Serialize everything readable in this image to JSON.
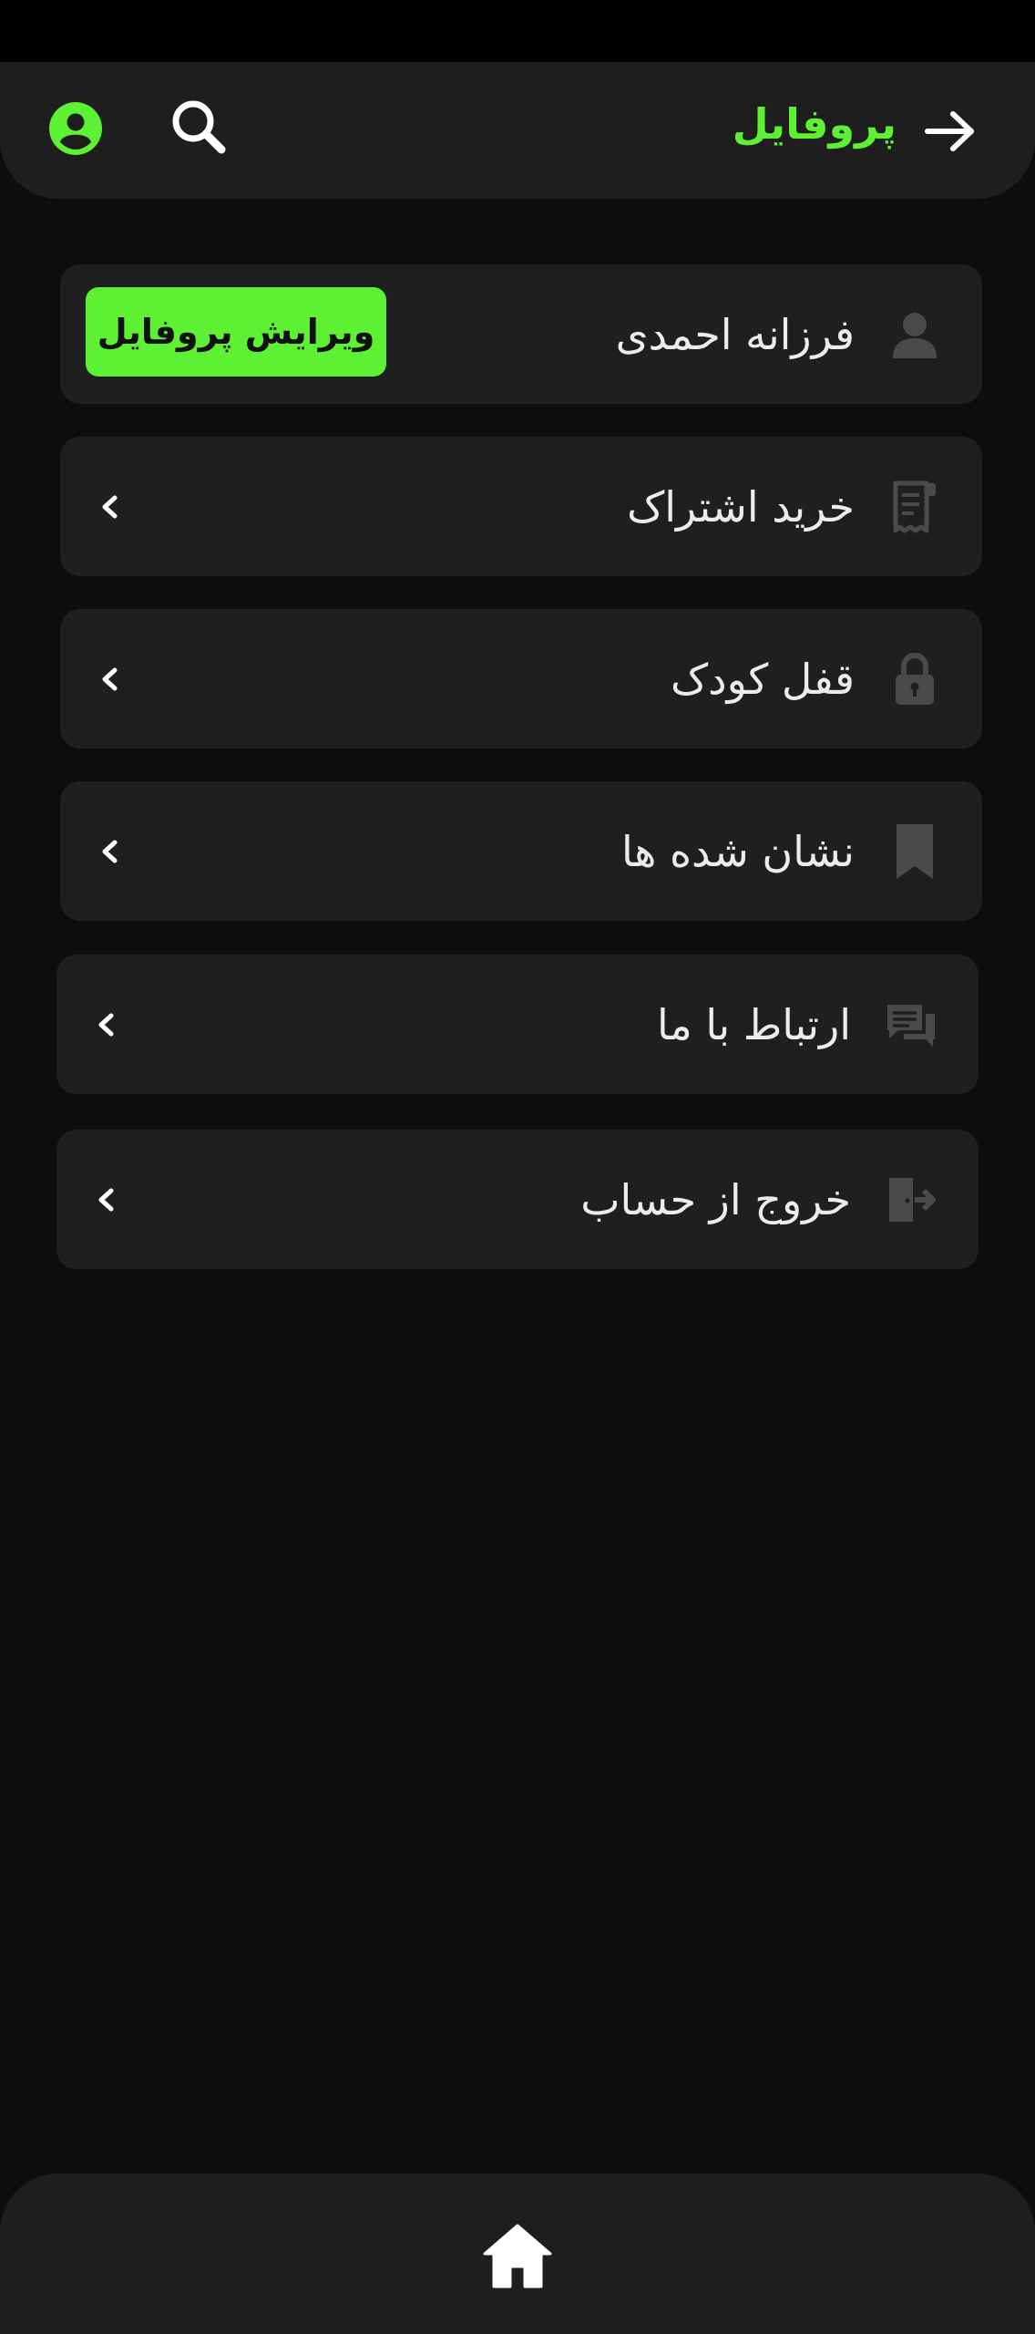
{
  "header": {
    "title": "پروفایل",
    "icons": {
      "back": "arrow-right-icon",
      "search": "search-icon",
      "profile": "account-circle-icon"
    }
  },
  "profile_card": {
    "user_name": "فرزانه احمدی",
    "edit_button_label": "ویرایش پروفایل",
    "icon": "user-icon"
  },
  "menu": {
    "items": [
      {
        "label": "خرید اشتراک",
        "icon": "receipt-icon"
      },
      {
        "label": "قفل کودک",
        "icon": "lock-icon"
      },
      {
        "label": "نشان شده ها",
        "icon": "bookmark-icon"
      },
      {
        "label": "ارتباط با ما",
        "icon": "chat-icon"
      },
      {
        "label": "خروج از حساب",
        "icon": "logout-icon"
      }
    ]
  },
  "bottom_nav": {
    "home_icon": "home-icon"
  },
  "colors": {
    "accent": "#5ef033",
    "background": "#0d0d0d",
    "surface": "#1f1f1f",
    "icon_muted": "#4a4a4a"
  }
}
